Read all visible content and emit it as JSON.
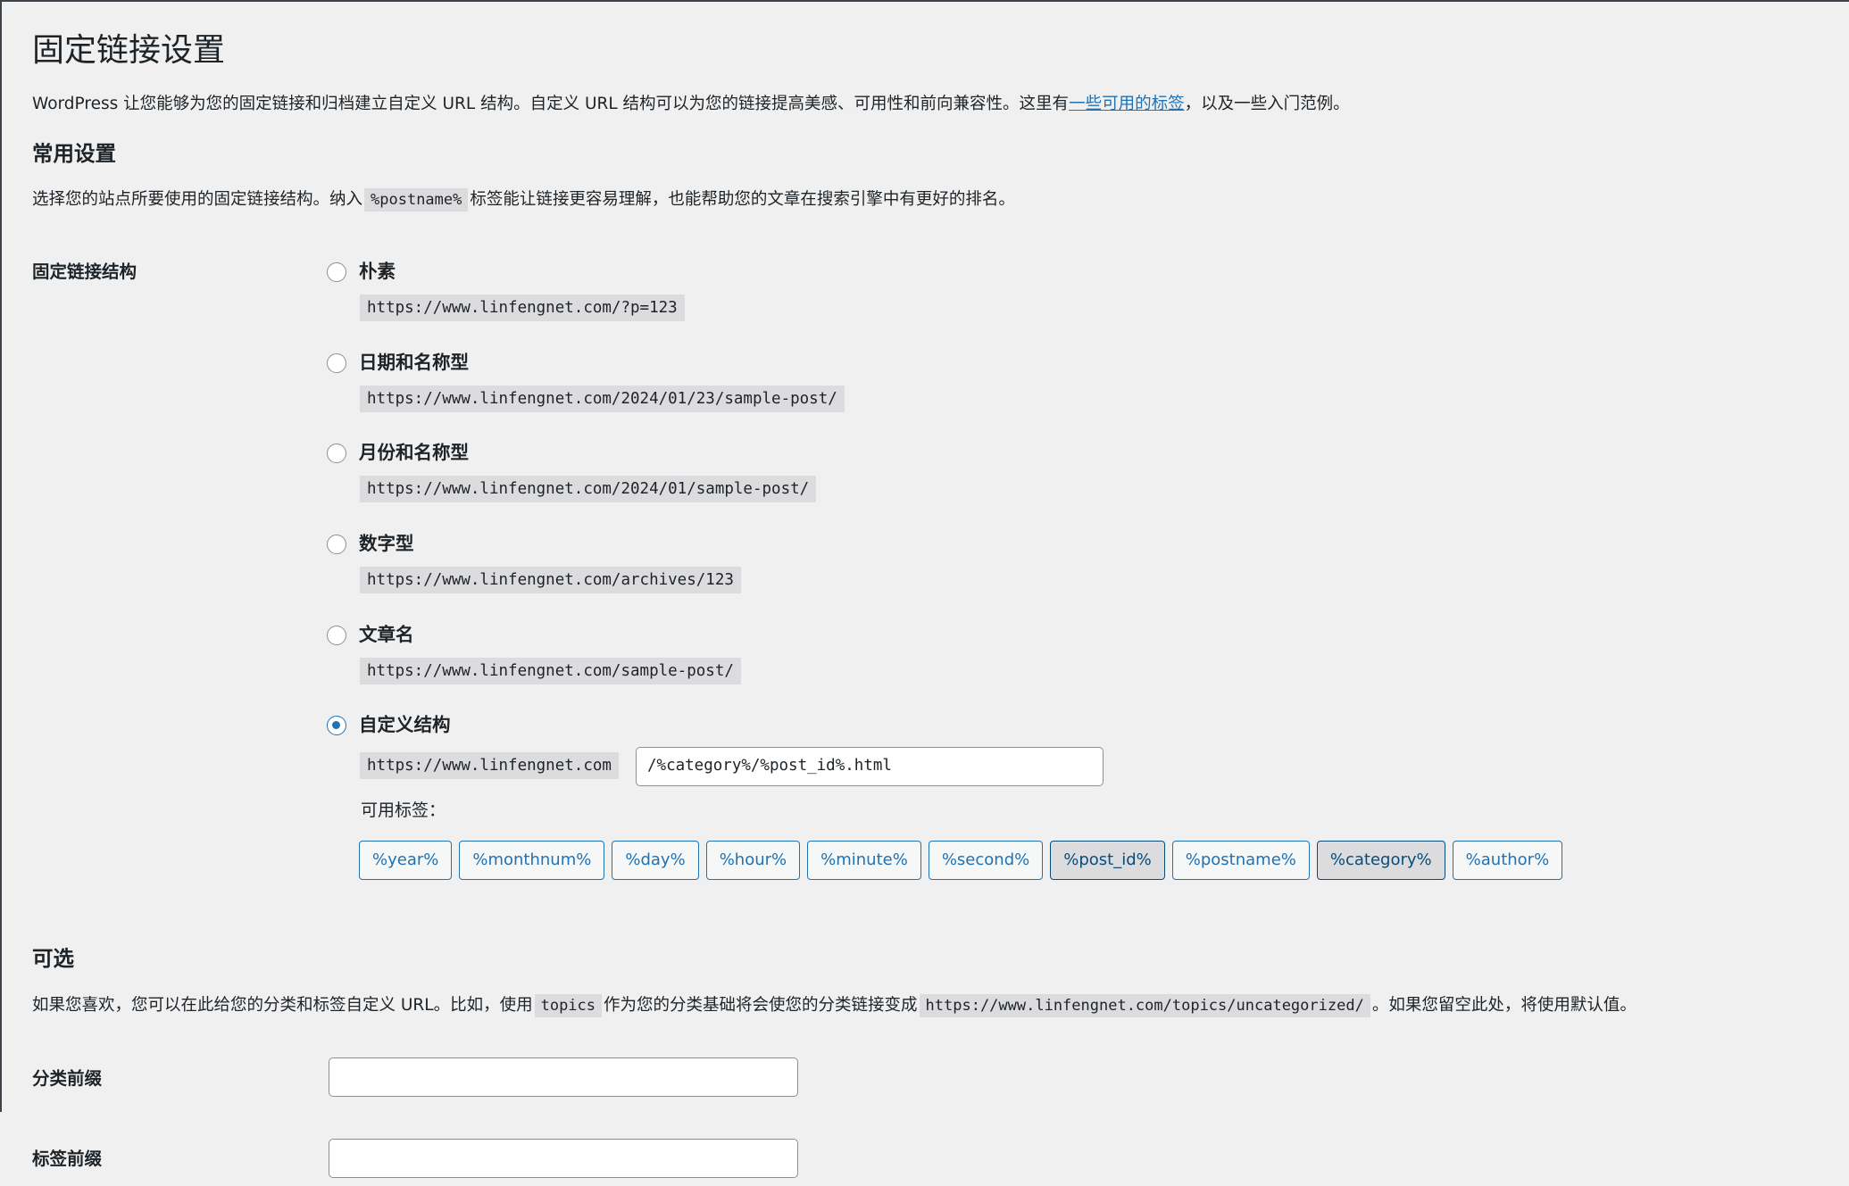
{
  "page": {
    "title": "固定链接设置",
    "intro_before": "WordPress 让您能够为您的固定链接和归档建立自定义 URL 结构。自定义 URL 结构可以为您的链接提高美感、可用性和前向兼容性。这里有",
    "intro_link": "一些可用的标签",
    "intro_after": "，以及一些入门范例。"
  },
  "common": {
    "title": "常用设置",
    "desc_before": "选择您的站点所要使用的固定链接结构。纳入",
    "desc_code": "%postname%",
    "desc_after": "标签能让链接更容易理解，也能帮助您的文章在搜索引擎中有更好的排名。",
    "row_label": "固定链接结构",
    "options": [
      {
        "label": "朴素",
        "example": "https://www.linfengnet.com/?p=123",
        "checked": false
      },
      {
        "label": "日期和名称型",
        "example": "https://www.linfengnet.com/2024/01/23/sample-post/",
        "checked": false
      },
      {
        "label": "月份和名称型",
        "example": "https://www.linfengnet.com/2024/01/sample-post/",
        "checked": false
      },
      {
        "label": "数字型",
        "example": "https://www.linfengnet.com/archives/123",
        "checked": false
      },
      {
        "label": "文章名",
        "example": "https://www.linfengnet.com/sample-post/",
        "checked": false
      },
      {
        "label": "自定义结构",
        "checked": true
      }
    ],
    "custom": {
      "prefix": "https://www.linfengnet.com",
      "value": "/%category%/%post_id%.html",
      "tags_label": "可用标签：",
      "tags": [
        {
          "label": "%year%",
          "active": false
        },
        {
          "label": "%monthnum%",
          "active": false
        },
        {
          "label": "%day%",
          "active": false
        },
        {
          "label": "%hour%",
          "active": false
        },
        {
          "label": "%minute%",
          "active": false
        },
        {
          "label": "%second%",
          "active": false
        },
        {
          "label": "%post_id%",
          "active": true
        },
        {
          "label": "%postname%",
          "active": false
        },
        {
          "label": "%category%",
          "active": true
        },
        {
          "label": "%author%",
          "active": false
        }
      ]
    }
  },
  "optional": {
    "title": "可选",
    "desc_before": "如果您喜欢，您可以在此给您的分类和标签自定义 URL。比如，使用",
    "desc_code1": "topics",
    "desc_middle": "作为您的分类基础将会使您的分类链接变成",
    "desc_code2": "https://www.linfengnet.com/topics/uncategorized/",
    "desc_after": "。如果您留空此处，将使用默认值。",
    "category_label": "分类前缀",
    "category_value": "",
    "tag_label": "标签前缀",
    "tag_value": ""
  }
}
